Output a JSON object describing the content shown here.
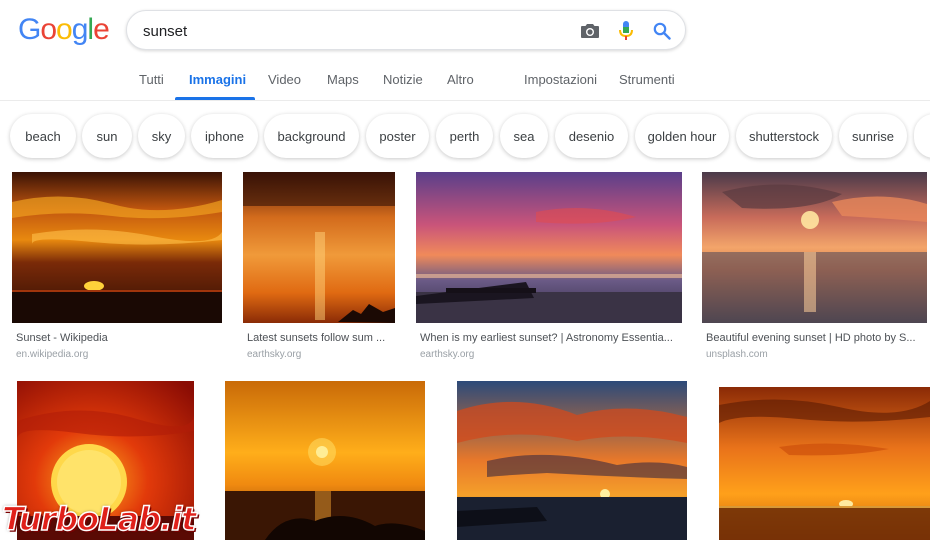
{
  "logo": {
    "text": "Google",
    "letters": [
      {
        "ch": "G",
        "color": "#4285F4"
      },
      {
        "ch": "o",
        "color": "#EA4335"
      },
      {
        "ch": "o",
        "color": "#FBBC05"
      },
      {
        "ch": "g",
        "color": "#4285F4"
      },
      {
        "ch": "l",
        "color": "#34A853"
      },
      {
        "ch": "e",
        "color": "#EA4335"
      }
    ]
  },
  "search": {
    "query": "sunset",
    "icons": {
      "camera": "camera-icon",
      "mic": "microphone-icon",
      "search": "search-icon"
    }
  },
  "tabs": [
    {
      "label": "Tutti",
      "active": false
    },
    {
      "label": "Immagini",
      "active": true
    },
    {
      "label": "Video",
      "active": false
    },
    {
      "label": "Maps",
      "active": false
    },
    {
      "label": "Notizie",
      "active": false
    },
    {
      "label": "Altro",
      "active": false
    },
    {
      "label": "Impostazioni",
      "active": false
    },
    {
      "label": "Strumenti",
      "active": false
    }
  ],
  "chips": [
    "beach",
    "sun",
    "sky",
    "iphone",
    "background",
    "poster",
    "perth",
    "sea",
    "desenio",
    "golden hour",
    "shutterstock",
    "sunrise"
  ],
  "results": [
    {
      "title": "Sunset - Wikipedia",
      "source": "en.wikipedia.org"
    },
    {
      "title": "Latest sunsets follow sum ...",
      "source": "earthsky.org"
    },
    {
      "title": "When is my earliest sunset? | Astronomy Essentia...",
      "source": "earthsky.org"
    },
    {
      "title": "Beautiful evening sunset | HD photo by S...",
      "source": "unsplash.com"
    },
    {
      "title": "",
      "source": ""
    },
    {
      "title": "",
      "source": ""
    },
    {
      "title": "",
      "source": ""
    },
    {
      "title": "",
      "source": ""
    }
  ],
  "watermark": "TurboLab.it",
  "colors": {
    "accent": "#1a73e8",
    "tab_text": "#5f6368",
    "source_text": "#9aa0a6"
  }
}
